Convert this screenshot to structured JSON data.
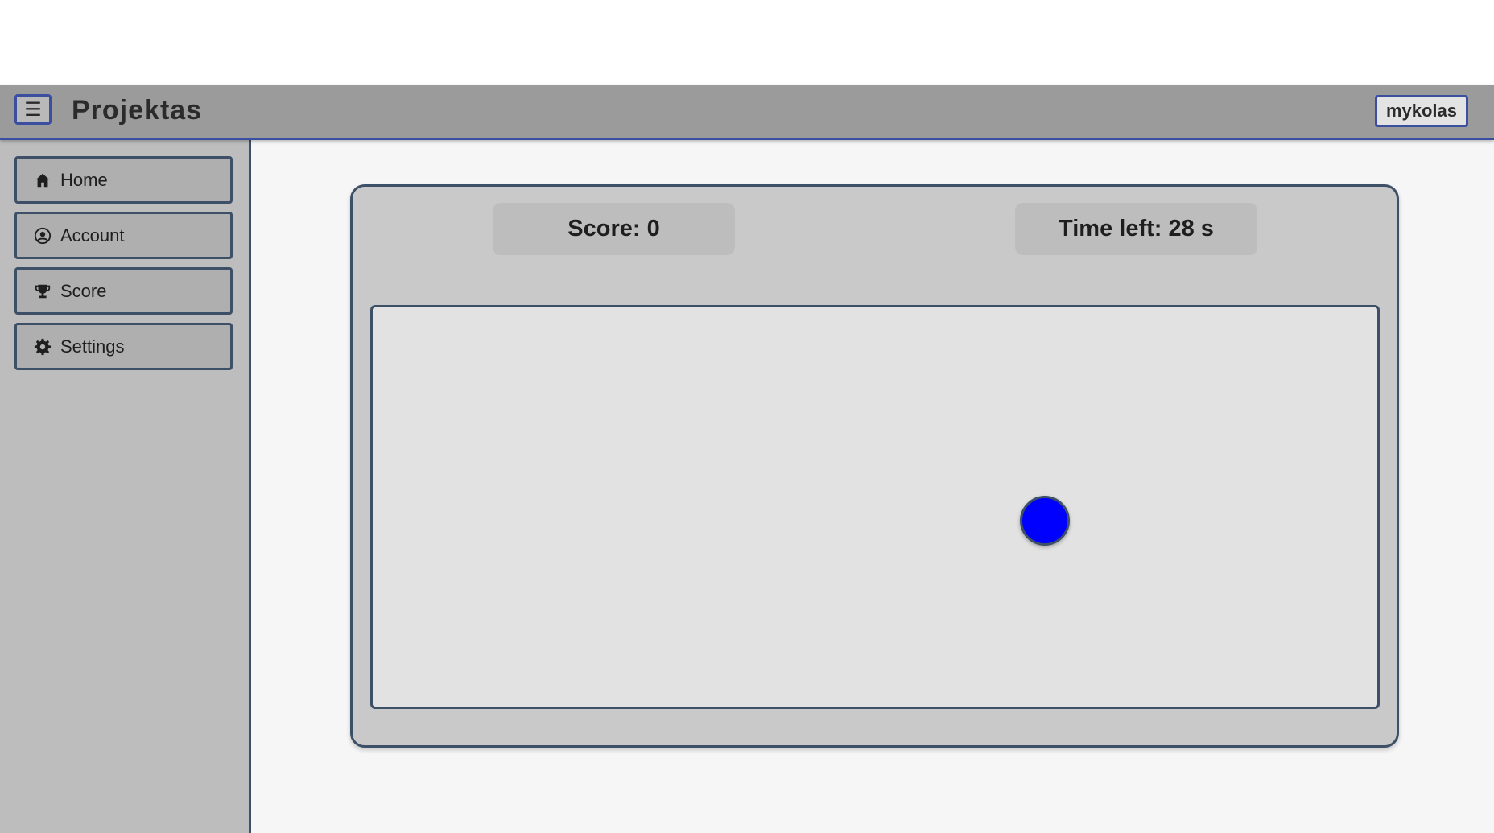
{
  "header": {
    "menu_icon": "hamburger-icon",
    "menu_glyph": "☰",
    "title": "Projektas",
    "user": "mykolas"
  },
  "sidebar": {
    "items": [
      {
        "label": "Home",
        "icon": "home-icon"
      },
      {
        "label": "Account",
        "icon": "user-circle-icon"
      },
      {
        "label": "Score",
        "icon": "trophy-icon"
      },
      {
        "label": "Settings",
        "icon": "gear-icon"
      }
    ]
  },
  "game": {
    "score_text": "Score: 0",
    "time_text": "Time left: 28 s",
    "target_color": "#0000ff"
  },
  "colors": {
    "header_bg": "#9b9b9b",
    "accent": "#3b4fa0",
    "border": "#3d5068",
    "sidebar_bg": "#bdbdbd"
  }
}
